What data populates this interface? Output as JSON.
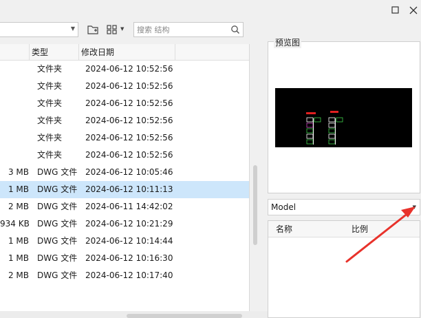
{
  "toolbar": {
    "path_value": "",
    "search_placeholder": "搜索 结构"
  },
  "file_list": {
    "columns": [
      "类型",
      "修改日期"
    ],
    "rows": [
      {
        "size": "",
        "type": "文件夹",
        "date": "2024-06-12 10:52:56",
        "selected": false
      },
      {
        "size": "",
        "type": "文件夹",
        "date": "2024-06-12 10:52:56",
        "selected": false
      },
      {
        "size": "",
        "type": "文件夹",
        "date": "2024-06-12 10:52:56",
        "selected": false
      },
      {
        "size": "",
        "type": "文件夹",
        "date": "2024-06-12 10:52:56",
        "selected": false
      },
      {
        "size": "",
        "type": "文件夹",
        "date": "2024-06-12 10:52:56",
        "selected": false
      },
      {
        "size": "",
        "type": "文件夹",
        "date": "2024-06-12 10:52:56",
        "selected": false
      },
      {
        "size": "3 MB",
        "type": "DWG 文件",
        "date": "2024-06-12 10:05:46",
        "selected": false
      },
      {
        "size": "1 MB",
        "type": "DWG 文件",
        "date": "2024-06-12 10:11:13",
        "selected": true
      },
      {
        "size": "2 MB",
        "type": "DWG 文件",
        "date": "2024-06-11 14:42:02",
        "selected": false
      },
      {
        "size": "934 KB",
        "type": "DWG 文件",
        "date": "2024-06-12 10:21:29",
        "selected": false
      },
      {
        "size": "1 MB",
        "type": "DWG 文件",
        "date": "2024-06-12 10:14:44",
        "selected": false
      },
      {
        "size": "1 MB",
        "type": "DWG 文件",
        "date": "2024-06-12 10:16:30",
        "selected": false
      },
      {
        "size": "2 MB",
        "type": "DWG 文件",
        "date": "2024-06-12 10:17:40",
        "selected": false
      }
    ]
  },
  "preview": {
    "label": "预览图"
  },
  "model_select": {
    "value": "Model"
  },
  "layout_table": {
    "columns": [
      "名称",
      "比例"
    ]
  },
  "colors": {
    "selected_row": "#cde6fb",
    "annotation_arrow": "#e8322b",
    "preview_bg": "#000000"
  }
}
